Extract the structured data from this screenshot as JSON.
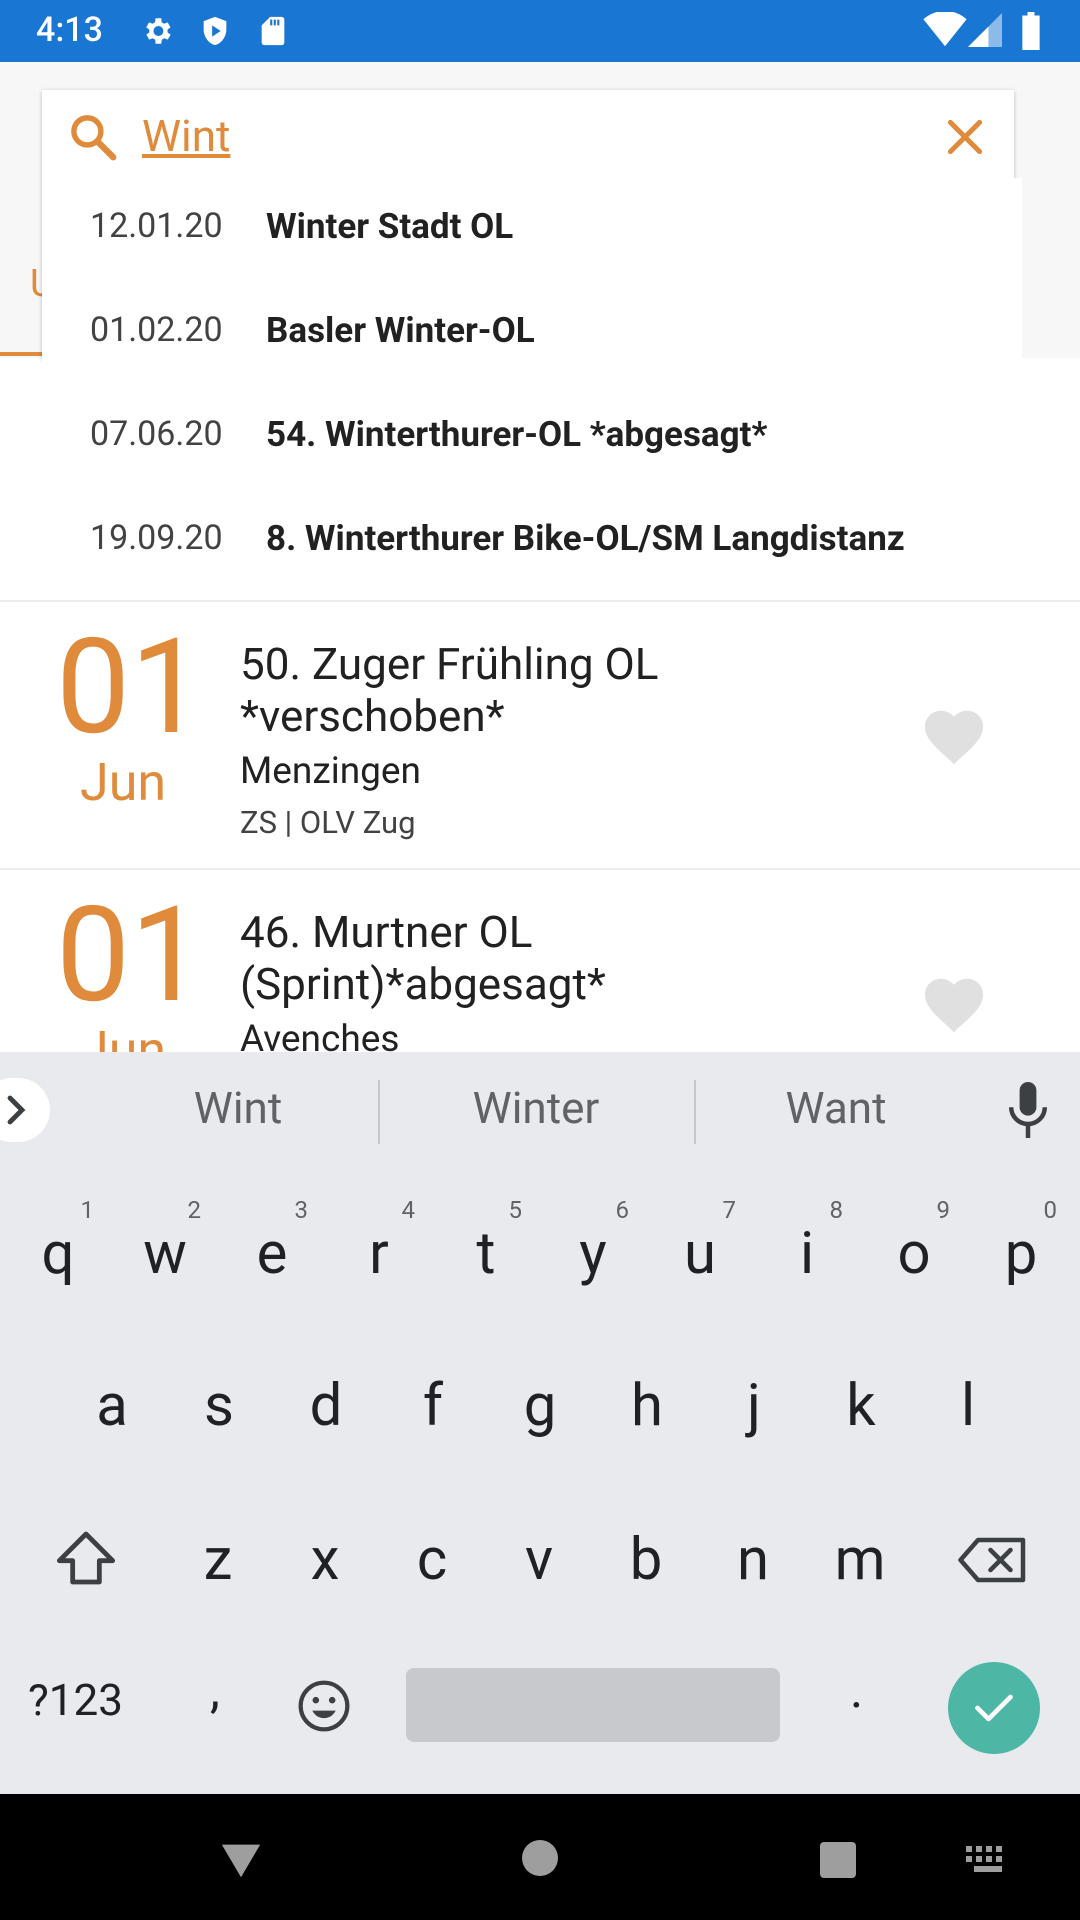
{
  "status_bar": {
    "time": "4:13"
  },
  "search": {
    "query": "Wint"
  },
  "suggestions": [
    {
      "date": "12.01.20",
      "name": "Winter Stadt OL"
    },
    {
      "date": "01.02.20",
      "name": "Basler Winter-OL"
    },
    {
      "date": "07.06.20",
      "name": "54. Winterthurer-OL *abgesagt*"
    },
    {
      "date": "19.09.20",
      "name": "8. Winterthurer Bike-OL/SM Langdistanz"
    }
  ],
  "background_tab_fragment": "U",
  "events": [
    {
      "day": "01",
      "month": "Jun",
      "title": "50. Zuger Frühling OL *verschoben*",
      "place": "Menzingen",
      "clubs": "ZS | OLV Zug"
    },
    {
      "day": "01",
      "month": "Jun",
      "title": "46. Murtner OL (Sprint)*abgesagt*",
      "place": "Avenches",
      "clubs": ""
    }
  ],
  "keyboard": {
    "suggestions": [
      "Wint",
      "Winter",
      "Want"
    ],
    "row1": [
      {
        "k": "q",
        "n": "1"
      },
      {
        "k": "w",
        "n": "2"
      },
      {
        "k": "e",
        "n": "3"
      },
      {
        "k": "r",
        "n": "4"
      },
      {
        "k": "t",
        "n": "5"
      },
      {
        "k": "y",
        "n": "6"
      },
      {
        "k": "u",
        "n": "7"
      },
      {
        "k": "i",
        "n": "8"
      },
      {
        "k": "o",
        "n": "9"
      },
      {
        "k": "p",
        "n": "0"
      }
    ],
    "row2": [
      "a",
      "s",
      "d",
      "f",
      "g",
      "h",
      "j",
      "k",
      "l"
    ],
    "row3": [
      "z",
      "x",
      "c",
      "v",
      "b",
      "n",
      "m"
    ],
    "symbols_label": "?123",
    "comma": ",",
    "period": "."
  },
  "colors": {
    "accent": "#e08a3c",
    "status_bar": "#1976d2",
    "keyboard_bg": "#e8eaed",
    "done_button": "#4db6a5"
  }
}
